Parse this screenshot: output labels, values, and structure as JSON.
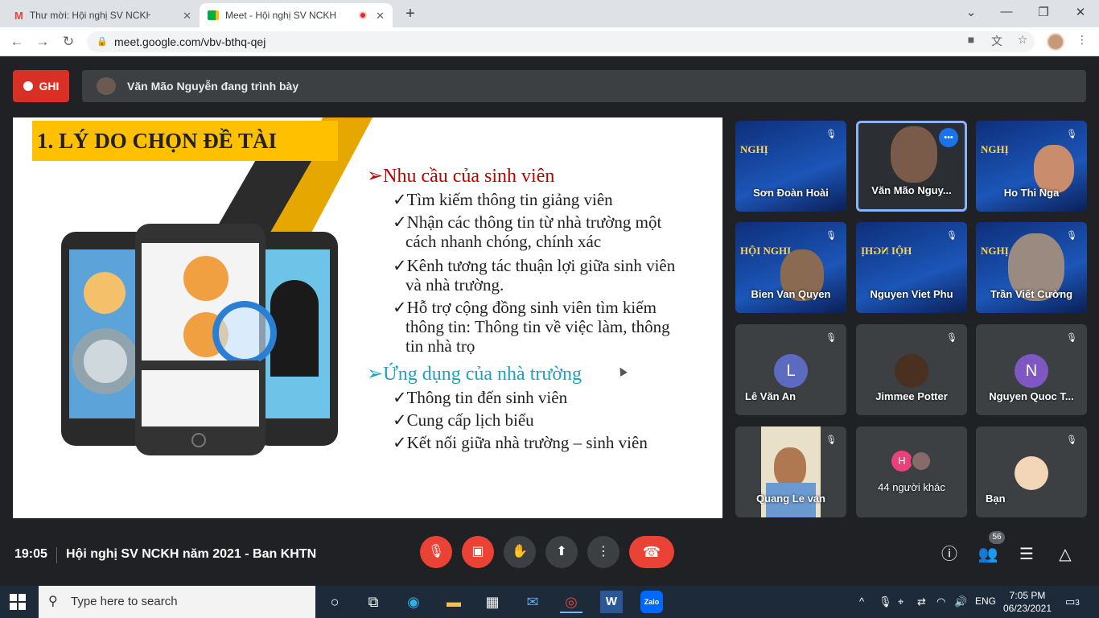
{
  "browser": {
    "tabs": [
      {
        "title": "Thư mời: Hội nghị SV NCKH năm",
        "icon": "gmail-icon",
        "active": false
      },
      {
        "title": "Meet - Hội nghị SV NCKH nă",
        "icon": "meet-icon",
        "active": true
      }
    ],
    "url": "meet.google.com/vbv-bthq-qej"
  },
  "meet": {
    "record_label": "GHI",
    "presenting_text": "Văn Mão Nguyễn đang trình bày",
    "slide": {
      "heading": "1. LÝ DO CHỌN ĐỀ TÀI",
      "section1": "➢Nhu cầu của sinh viên",
      "items1": [
        "✓Tìm kiếm thông tin giảng viên",
        "✓Nhận các thông tin từ nhà trường một",
        "cách nhanh chóng, chính xác",
        "✓Kênh tương tác thuận lợi giữa sinh viên",
        "và nhà trường.",
        "✓Hỗ trợ cộng đồng sinh viên tìm kiếm",
        "thông tin: Thông tin về việc làm, thông",
        "tin nhà trọ"
      ],
      "section2": "➢Ứng dụng của nhà trường",
      "items2": [
        "✓Thông tin đến sinh viên",
        "✓Cung cấp lịch biểu",
        "✓Kết nối giữa nhà trường – sinh viên"
      ],
      "colors": {
        "heading_bg": "#ffc000",
        "section1": "#c00000",
        "section2": "#1aa3c5"
      }
    },
    "participants": [
      {
        "name": "Sơn Đoàn Hoài",
        "type": "poster",
        "muted": true
      },
      {
        "name": "Văn Mão Nguy...",
        "type": "video",
        "speaking": true
      },
      {
        "name": "Ho Thi Nga",
        "type": "poster",
        "muted": true
      },
      {
        "name": "Bien Van Quyen",
        "type": "poster",
        "muted": true
      },
      {
        "name": "Nguyen Viet Phu",
        "type": "poster",
        "muted": true
      },
      {
        "name": "Trần Viết Cường",
        "type": "poster",
        "muted": true
      },
      {
        "name": "Lê Văn An",
        "type": "letter",
        "letter": "L",
        "color": "#5c6bc0",
        "muted": true
      },
      {
        "name": "Jimmee Potter",
        "type": "avatar",
        "muted": true
      },
      {
        "name": "Nguyen Quoc T...",
        "type": "letter",
        "letter": "N",
        "color": "#7e57c2",
        "muted": true
      },
      {
        "name": "Quang Le van",
        "type": "video",
        "muted": true
      },
      {
        "name": "44 người khác",
        "type": "others",
        "letter": "H"
      },
      {
        "name": "Bạn",
        "type": "avatar",
        "muted": true
      }
    ],
    "bottom": {
      "time": "19:05",
      "meeting_title": "Hội nghị SV NCKH năm 2021 - Ban KHTN",
      "participant_count": "56"
    }
  },
  "taskbar": {
    "search_placeholder": "Type here to search",
    "language": "ENG",
    "time": "7:05 PM",
    "date": "06/23/2021",
    "notifications": "3"
  }
}
